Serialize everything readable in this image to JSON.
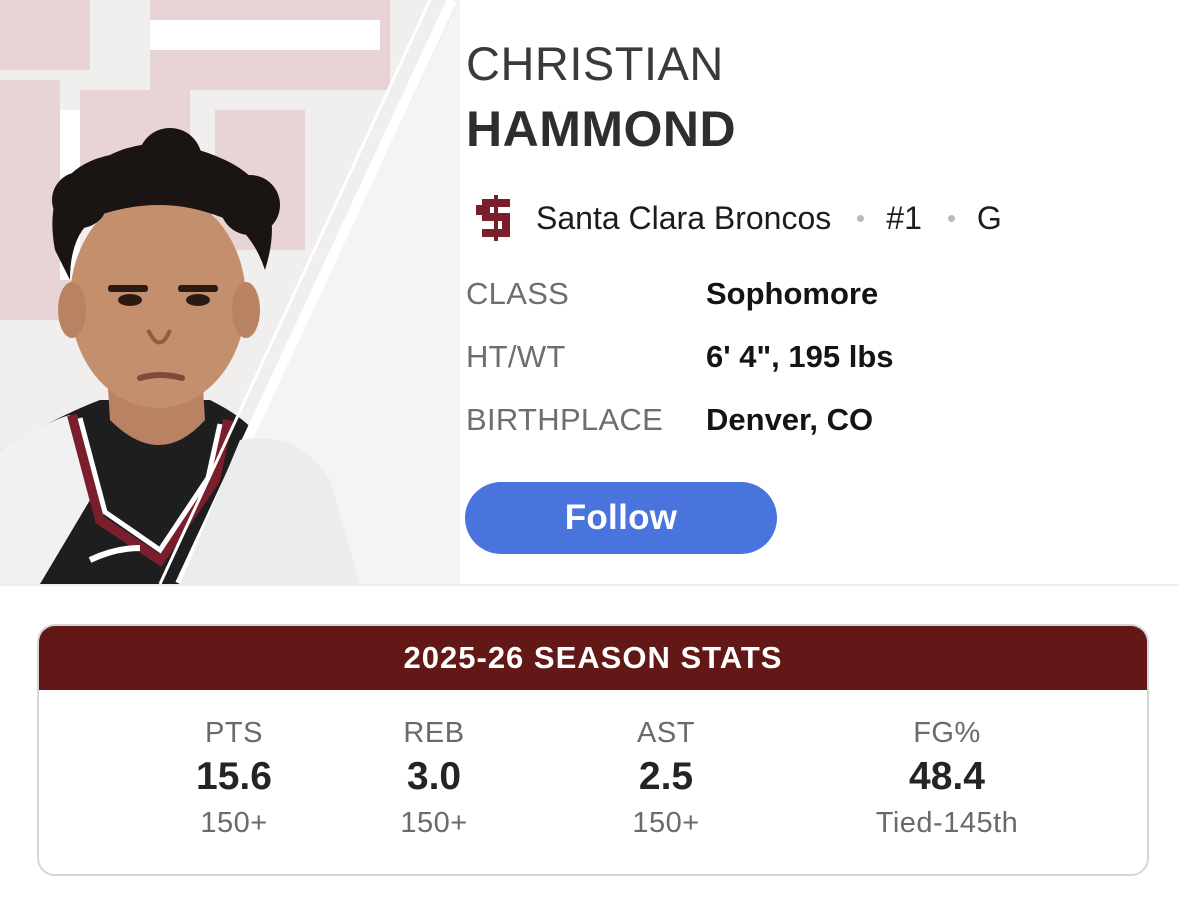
{
  "player": {
    "first_name": "CHRISTIAN",
    "last_name": "HAMMOND",
    "team": "Santa Clara Broncos",
    "number": "#1",
    "position": "G"
  },
  "info": [
    {
      "label": "CLASS",
      "value": "Sophomore"
    },
    {
      "label": "HT/WT",
      "value": "6' 4\", 195 lbs"
    },
    {
      "label": "BIRTHPLACE",
      "value": "Denver, CO"
    }
  ],
  "follow_label": "Follow",
  "stats": {
    "title": "2025-26 SEASON STATS",
    "columns": [
      {
        "label": "PTS",
        "value": "15.6",
        "rank": "150+"
      },
      {
        "label": "REB",
        "value": "3.0",
        "rank": "150+"
      },
      {
        "label": "AST",
        "value": "2.5",
        "rank": "150+"
      },
      {
        "label": "FG%",
        "value": "48.4",
        "rank": "Tied-145th"
      }
    ]
  },
  "colors": {
    "brand_maroon": "#611816",
    "follow_blue": "#4a74dd",
    "logo_maroon": "#7a1e2c"
  },
  "icons": {
    "team_logo": "santa-clara-sc-logo",
    "player_photo": "player-headshot"
  }
}
